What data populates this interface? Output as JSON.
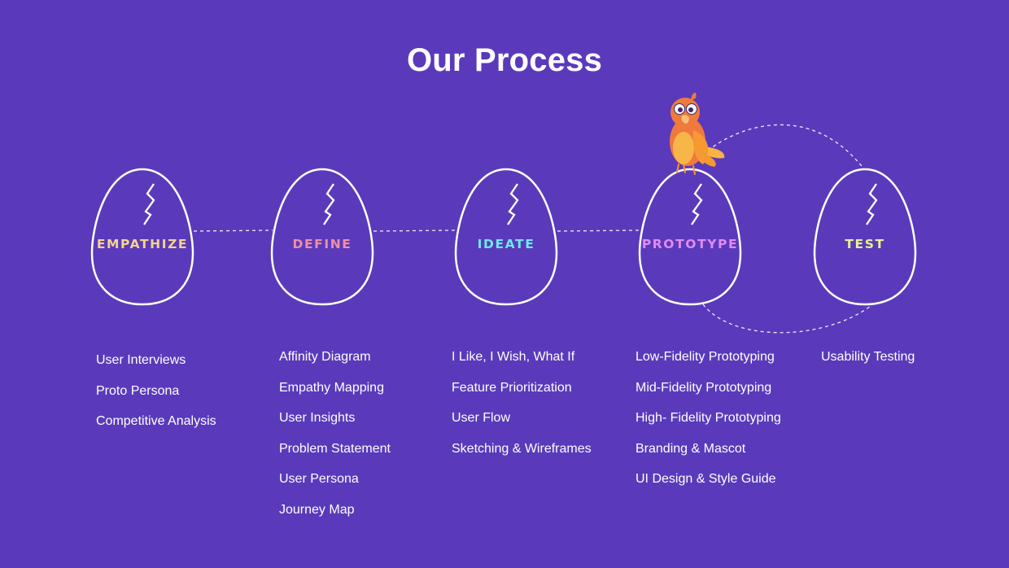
{
  "title": "Our Process",
  "stages": [
    {
      "label": "EMPATHIZE",
      "color": "#f4d38a",
      "activities": [
        "User Interviews",
        "Proto Persona",
        "Competitive Analysis"
      ]
    },
    {
      "label": "DEFINE",
      "color": "#ef8fa5",
      "activities": [
        "Affinity Diagram",
        "Empathy Mapping",
        "User Insights",
        "Problem Statement",
        "User Persona",
        "Journey Map"
      ]
    },
    {
      "label": "IDEATE",
      "color": "#6fe7ee",
      "activities": [
        "I Like, I Wish, What If",
        "Feature Prioritization",
        "User Flow",
        "Sketching & Wireframes"
      ]
    },
    {
      "label": "PROTOTYPE",
      "color": "#df8cf2",
      "activities": [
        "Low-Fidelity Prototyping",
        "Mid-Fidelity Prototyping",
        "High- Fidelity Prototyping",
        "Branding & Mascot",
        "UI Design & Style Guide"
      ]
    },
    {
      "label": "TEST",
      "color": "#e6f28e",
      "activities": [
        "Usability Testing"
      ]
    }
  ],
  "mascot": {
    "icon": "parrot-mascot-icon"
  },
  "colors": {
    "background": "#5a3abb",
    "stroke": "#ffffff"
  }
}
